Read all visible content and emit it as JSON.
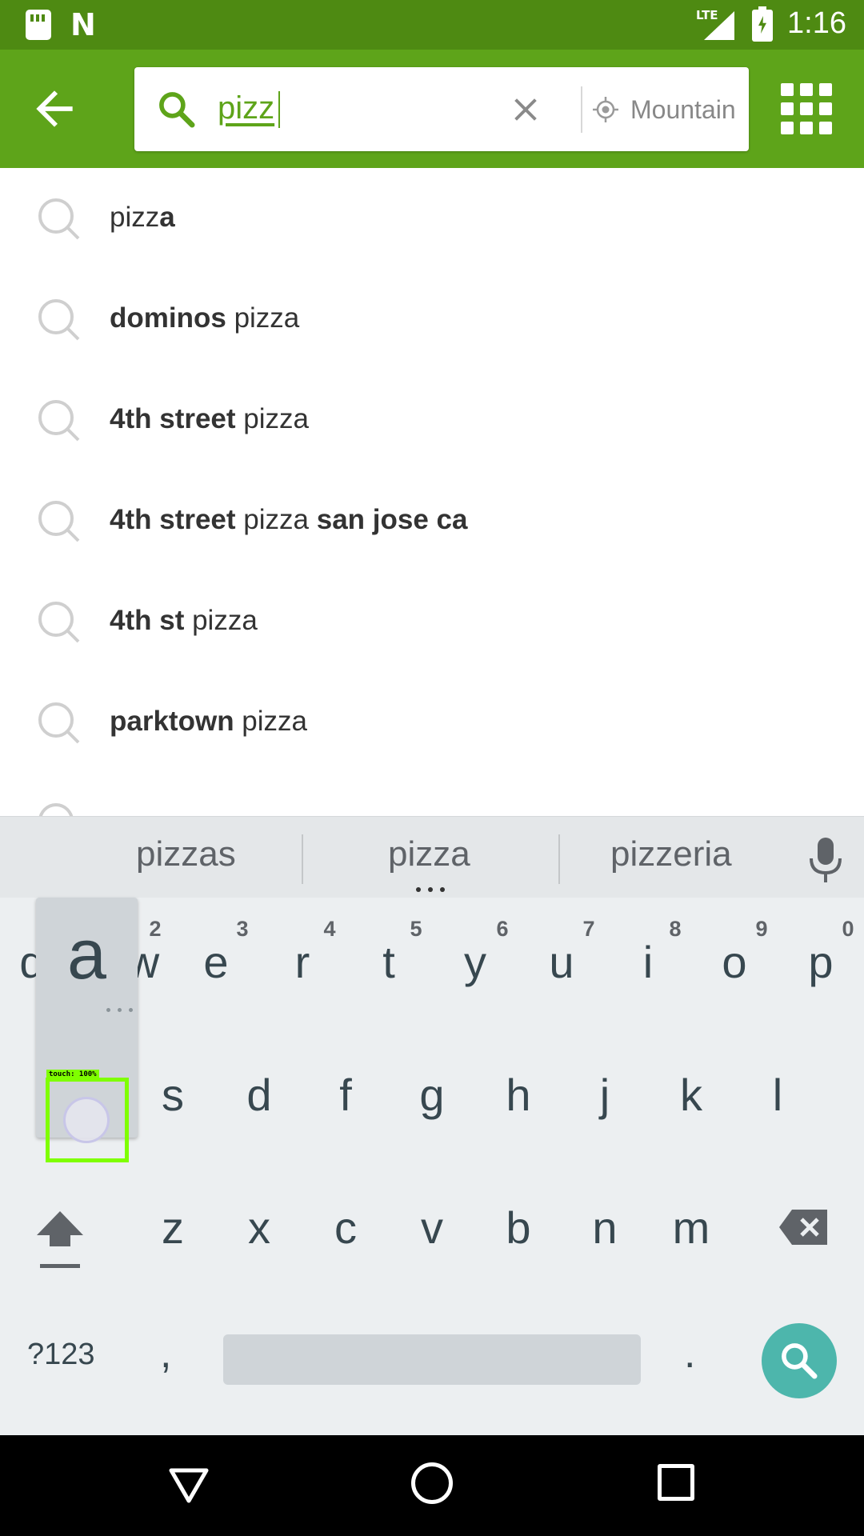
{
  "status_bar": {
    "network": "LTE",
    "time": "1:16"
  },
  "search": {
    "query": "pizz",
    "location": "Mountain"
  },
  "suggestions": [
    {
      "bold_prefix": "",
      "normal": "pizz",
      "bold_suffix": "a"
    },
    {
      "bold_prefix": "dominos ",
      "normal": "pizza",
      "bold_suffix": ""
    },
    {
      "bold_prefix": "4th street ",
      "normal": "pizza",
      "bold_suffix": ""
    },
    {
      "bold_prefix": "4th street ",
      "normal": "pizza",
      "bold_suffix": " san jose ca"
    },
    {
      "bold_prefix": "4th st ",
      "normal": "pizza",
      "bold_suffix": ""
    },
    {
      "bold_prefix": "parktown ",
      "normal": "pizza",
      "bold_suffix": ""
    }
  ],
  "keyboard": {
    "word_suggestions": [
      "pizzas",
      "pizza",
      "pizzeria"
    ],
    "row1": [
      {
        "letter": "q",
        "hint": "1"
      },
      {
        "letter": "w",
        "hint": "2"
      },
      {
        "letter": "e",
        "hint": "3"
      },
      {
        "letter": "r",
        "hint": "4"
      },
      {
        "letter": "t",
        "hint": "5"
      },
      {
        "letter": "y",
        "hint": "6"
      },
      {
        "letter": "u",
        "hint": "7"
      },
      {
        "letter": "i",
        "hint": "8"
      },
      {
        "letter": "o",
        "hint": "9"
      },
      {
        "letter": "p",
        "hint": "0"
      }
    ],
    "row2": [
      "a",
      "s",
      "d",
      "f",
      "g",
      "h",
      "j",
      "k",
      "l"
    ],
    "row3": [
      "z",
      "x",
      "c",
      "v",
      "b",
      "n",
      "m"
    ],
    "symbols_label": "?123",
    "comma": ",",
    "period": ".",
    "popup_letter": "a"
  },
  "touch_overlay": {
    "label": "touch: 100%"
  },
  "colors": {
    "status_bar": "#4e8a12",
    "app_bar": "#5ea41a",
    "keyboard_bg": "#eceff1",
    "search_key": "#4db6ac",
    "touch_box": "#7fff00"
  }
}
